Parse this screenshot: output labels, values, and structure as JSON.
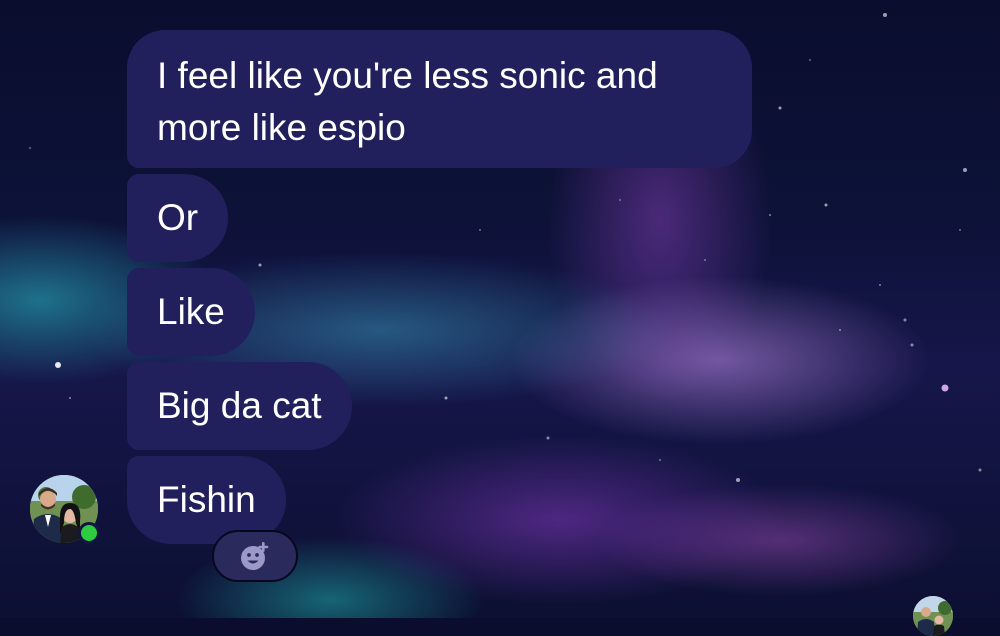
{
  "messages": [
    {
      "text": "I feel like you're less sonic and more like espio"
    },
    {
      "text": "Or"
    },
    {
      "text": "Like"
    },
    {
      "text": "Big da cat"
    },
    {
      "text": "Fishin"
    }
  ],
  "sender_avatar": {
    "presence": "online",
    "presence_color": "#2ecc40"
  },
  "reaction_button": {
    "icon": "add-reaction-icon"
  },
  "read_receipt": {
    "icon": "seen-avatar"
  },
  "colors": {
    "bubble": "#22205c",
    "bubble_text": "#ffffff",
    "reaction_button_bg": "#2b2a5c",
    "reaction_icon": "#9c98c8"
  }
}
